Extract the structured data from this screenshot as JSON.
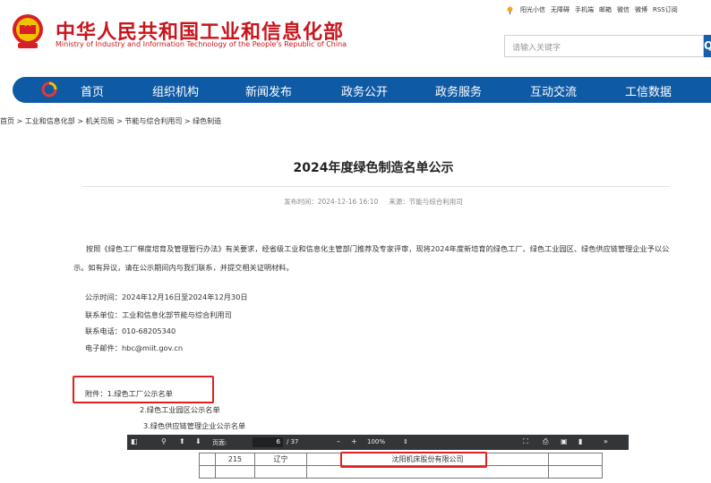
{
  "header": {
    "title": "中华人民共和国工业和信息化部",
    "subtitle": "Ministry of Industry and Information Technology of the People's Republic of China",
    "top_links": [
      "阳光小信",
      "无障碍",
      "手机端",
      "邮箱",
      "微信",
      "微博",
      "RSS订阅"
    ],
    "search_placeholder": "请输入关键字",
    "search_button": "Q",
    "brand_color": "#c8161d",
    "nav_color": "#0f5aa5"
  },
  "nav": {
    "items": [
      "首页",
      "组织机构",
      "新闻发布",
      "政务公开",
      "政务服务",
      "互动交流",
      "工信数据"
    ]
  },
  "breadcrumb": "首页 > 工业和信息化部 > 机关司局 > 节能与综合利用司 > 绿色制造",
  "article": {
    "title": "2024年度绿色制造名单公示",
    "publish_label": "发布时间：2024-12-16 16:10",
    "source_label": "来源：节能与综合利用司",
    "paragraph": "按照《绿色工厂梯度培育及管理暂行办法》有关要求，经省级工业和信息化主管部门推荐及专家评审，现将2024年度新培育的绿色工厂、绿色工业园区、绿色供应链管理企业予以公示。如有异议，请在公示期间内与我们联系，并提交相关证明材料。",
    "info": [
      "公示时间：2024年12月16日至2024年12月30日",
      "联系单位：工业和信息化部节能与综合利用司",
      "联系电话：010-68205340",
      "电子邮件：hbc@miit.gov.cn"
    ],
    "attachments": [
      "附件：1.绿色工厂公示名单",
      "2.绿色工业园区公示名单",
      "3.绿色供应链管理企业公示名单"
    ]
  },
  "pdf_viewer": {
    "page_label": "页面:",
    "page_current": "6",
    "page_total": "/ 37",
    "zoom": "100%",
    "minus": "–",
    "plus": "+",
    "more": "»",
    "row": {
      "number": "215",
      "province": "辽宁",
      "company": "沈阳机床股份有限公司"
    }
  }
}
